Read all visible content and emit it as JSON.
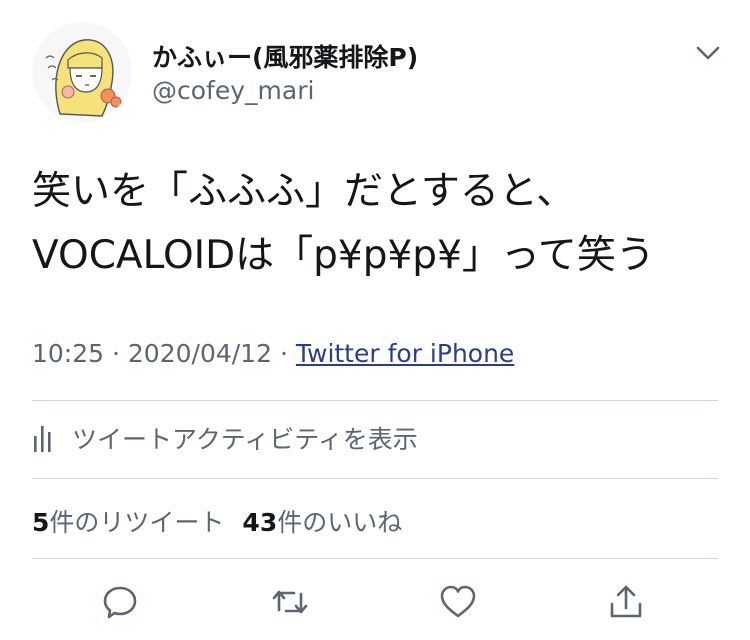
{
  "author": {
    "display_name": "かふぃー(風邪薬排除P)",
    "handle": "@cofey_mari"
  },
  "tweet": {
    "lines": [
      "笑いを「ふふふ」だとすると、",
      "VOCALOIDは「p¥p¥p¥」って笑う"
    ]
  },
  "meta": {
    "time": "10:25",
    "separator": "·",
    "date": "2020/04/12",
    "source": "Twitter for iPhone"
  },
  "activity": {
    "label": "ツイートアクティビティを表示",
    "icon": "bar-chart-icon"
  },
  "stats": {
    "retweets": {
      "count": "5",
      "label": "件のリツイート"
    },
    "likes": {
      "count": "43",
      "label": "件のいいね"
    }
  },
  "actions": [
    {
      "name": "reply",
      "icon": "comment-bubble-icon"
    },
    {
      "name": "retweet",
      "icon": "retweet-arrows-icon"
    },
    {
      "name": "like",
      "icon": "heart-icon"
    },
    {
      "name": "share",
      "icon": "share-upload-icon"
    }
  ],
  "colors": {
    "text_primary": "#14171a",
    "text_secondary": "#5b6670",
    "link": "#2b3e8c",
    "divider": "#cfd6dc",
    "icon": "#5b6670"
  }
}
